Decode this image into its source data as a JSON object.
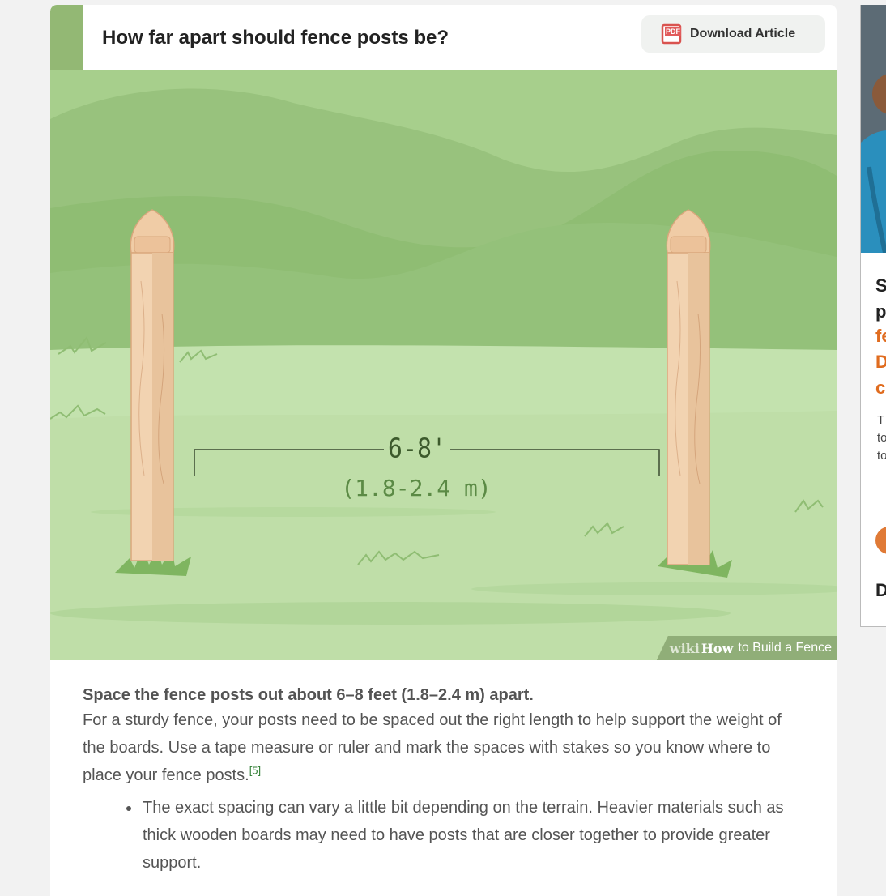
{
  "step": {
    "title": "How far apart should fence posts be?",
    "download_label": "Download Article",
    "pdf_icon_text": "PDF"
  },
  "image": {
    "measure_top": "6-8'",
    "measure_bottom": "(1.8-2.4 m)",
    "watermark_wiki": "wiki",
    "watermark_how": "How",
    "watermark_rest": "to Build a Fence"
  },
  "content": {
    "lead": "Space the fence posts out about 6–8 feet (1.8–2.4 m) apart.",
    "body": "For a sturdy fence, your posts need to be spaced out the right length to help support the weight of the boards. Use a tape measure or ruler and mark the spaces with stakes so you know where to place your fence posts.",
    "citation": "[5]",
    "bullets": [
      "The exact spacing can vary a little bit depending on the terrain. Heavier materials such as thick wooden boards may need to have posts that are closer together to provide greater support."
    ]
  },
  "side_panel": {
    "letters": [
      "S",
      "p",
      "fe",
      "D",
      "c"
    ],
    "small": [
      "T",
      "to",
      "to"
    ],
    "bottom_letter": "D"
  },
  "colors": {
    "accent_green": "#93b874",
    "orange": "#e07a36"
  }
}
